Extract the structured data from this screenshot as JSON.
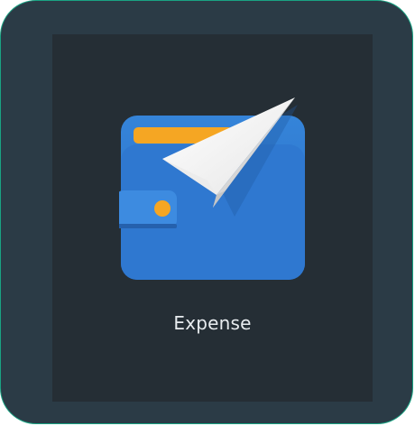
{
  "app": {
    "label": "Expense",
    "icon": "wallet-with-paper-plane-icon"
  },
  "colors": {
    "frame_border": "#1aa383",
    "frame_bg": "#2b3b46",
    "tile_bg": "#252e35",
    "wallet_blue": "#2f78d0",
    "wallet_card": "#f5a623",
    "plane_white": "#f3f3f3",
    "label_text": "#e8ecef"
  }
}
